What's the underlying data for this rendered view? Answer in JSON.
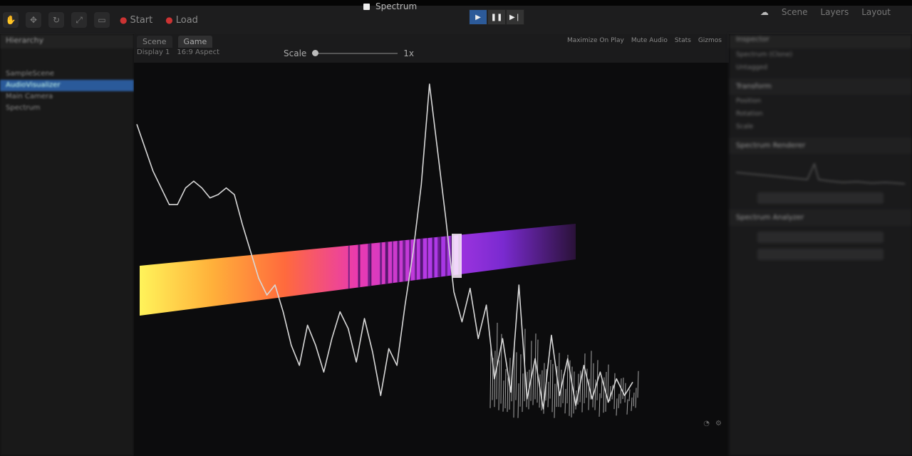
{
  "topbar": {
    "title_prefix": "Spectrum",
    "left_groups": [
      {
        "icon": "record-icon",
        "label": "Start"
      },
      {
        "icon": "record-icon",
        "label": "Load"
      }
    ],
    "right_items": [
      "Scene",
      "Layers",
      "Layout"
    ]
  },
  "scene_tabs": {
    "scene": "Scene",
    "game": "Game",
    "display": "Display 1",
    "aspect": "16:9 Aspect"
  },
  "scale": {
    "label": "Scale",
    "value": "1x",
    "fraction": 0.0
  },
  "view_options": [
    "Maximize On Play",
    "Mute Audio",
    "Stats",
    "Gizmos"
  ],
  "hierarchy": {
    "title": "Hierarchy",
    "items": [
      "SampleScene",
      "AudioVisualizer",
      "Main Camera",
      "Spectrum"
    ],
    "selected_index": 1
  },
  "inspector": {
    "title": "Inspector",
    "object_name": "Spectrum (Clone)",
    "tag": "Untagged",
    "transform": "Transform",
    "rows": [
      "Position",
      "Rotation",
      "Scale"
    ],
    "sections": [
      "Spectrum Renderer",
      "Spectrum Analyzer"
    ]
  },
  "colors": {
    "play_active": "#2c5a99",
    "waveform": "#d8d8d8",
    "spectrum_stops": [
      "#fff35a",
      "#ffb03a",
      "#ff6a3d",
      "#e93ab0",
      "#b23ae8",
      "#7a2ad0",
      "#2a1238"
    ]
  },
  "spectrum": {
    "waveform_y": [
      0.12,
      0.19,
      0.26,
      0.31,
      0.36,
      0.36,
      0.31,
      0.29,
      0.31,
      0.34,
      0.33,
      0.31,
      0.33,
      0.42,
      0.5,
      0.58,
      0.63,
      0.6,
      0.68,
      0.78,
      0.84,
      0.72,
      0.78,
      0.86,
      0.76,
      0.68,
      0.73,
      0.83,
      0.7,
      0.8,
      0.93,
      0.79,
      0.84,
      0.66,
      0.5,
      0.3,
      0.0,
      0.2,
      0.4,
      0.62,
      0.71,
      0.61,
      0.76,
      0.66,
      0.88,
      0.76,
      0.92,
      0.6,
      0.94,
      0.82,
      0.97,
      0.75,
      0.93,
      0.82,
      0.96,
      0.84,
      0.94,
      0.86,
      0.95,
      0.88,
      0.93,
      0.89
    ],
    "bar_lines": [
      0.48,
      0.5,
      0.52,
      0.53,
      0.55,
      0.56,
      0.58,
      0.59,
      0.6,
      0.62,
      0.63,
      0.64,
      0.66,
      0.67,
      0.68,
      0.69,
      0.7,
      0.71,
      0.72,
      0.73
    ]
  }
}
